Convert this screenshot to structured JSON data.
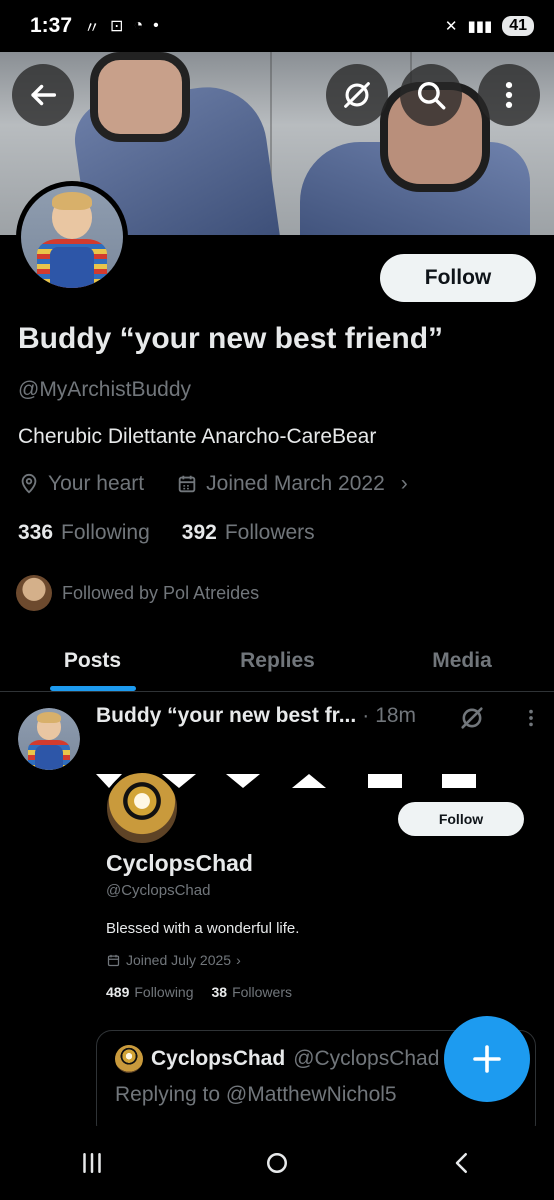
{
  "status_bar": {
    "time": "1:37",
    "battery": "41"
  },
  "profile": {
    "display_name": "Buddy “your new best friend”",
    "handle": "@MyArchistBuddy",
    "bio": "Cherubic Dilettante Anarcho-CareBear",
    "location": "Your heart",
    "joined": "Joined March 2022",
    "following_count": "336",
    "following_label": "Following",
    "followers_count": "392",
    "followers_label": "Followers",
    "followed_by": "Followed by Pol Atreides",
    "follow_label": "Follow"
  },
  "tabs": [
    {
      "label": "Posts",
      "active": true
    },
    {
      "label": "Replies",
      "active": false
    },
    {
      "label": "Media",
      "active": false
    }
  ],
  "post": {
    "author_name": "Buddy “your new best fr...",
    "separator": "·",
    "time": "18m",
    "embed": {
      "name": "CyclopsChad",
      "handle": "@CyclopsChad",
      "follow_label": "Follow",
      "bio": "Blessed with a wonderful life.",
      "joined": "Joined July 2025",
      "following_count": "489",
      "following_label": "Following",
      "followers_count": "38",
      "followers_label": "Followers"
    },
    "quote": {
      "name": "CyclopsChad",
      "handle": "@CyclopsChad",
      "replying_to": "Replying to @MatthewNichol5"
    }
  },
  "colors": {
    "accent": "#1d9bf0",
    "background": "#000000",
    "muted_text": "#71767b",
    "primary_text": "#e7e9ea"
  },
  "icons": {
    "back": "arrow-left-icon",
    "grok": "grok-icon",
    "search": "search-icon",
    "more": "more-vertical-icon",
    "location": "location-pin-icon",
    "calendar": "calendar-icon",
    "compose": "plus-icon"
  }
}
